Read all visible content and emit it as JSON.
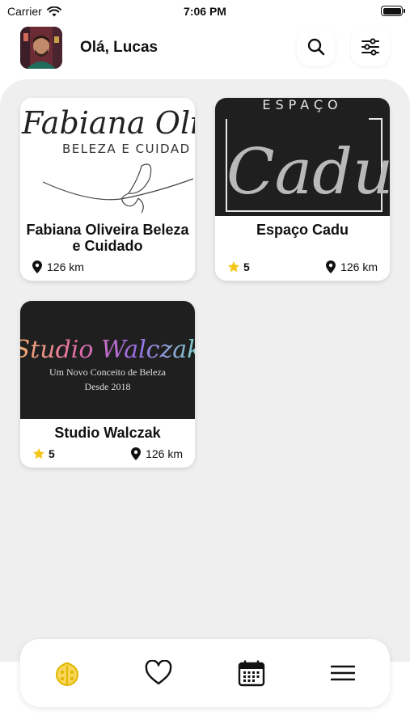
{
  "status_bar": {
    "carrier": "Carrier",
    "time": "7:06 PM"
  },
  "header": {
    "greeting": "Olá, Lucas"
  },
  "salons": [
    {
      "name": "Fabiana Oliveira Beleza e Cuidado",
      "distance": "126 km",
      "logo_text": {
        "line1": "Fabiana Oli",
        "line2": "BELEZA E CUIDAD"
      }
    },
    {
      "name": "Espaço Cadu",
      "rating": "5",
      "distance": "126 km",
      "logo_text": {
        "line1": "ESPAÇO",
        "line2": "Cadu"
      }
    },
    {
      "name": "Studio Walczak",
      "rating": "5",
      "distance": "126 km",
      "logo_text": {
        "line1": "Studio Walczak",
        "line2": "Um Novo Conceito de Beleza",
        "line3": "Desde 2018"
      }
    }
  ],
  "icons": {
    "search": "search-icon",
    "filter": "sliders-icon",
    "rating": "star-icon",
    "location": "location-pin-icon",
    "nav": [
      "ladybug-icon",
      "heart-icon",
      "calendar-icon",
      "menu-icon"
    ]
  },
  "colors": {
    "accent": "#f5c518",
    "background": "#efefef",
    "card": "#ffffff",
    "text": "#111111"
  }
}
